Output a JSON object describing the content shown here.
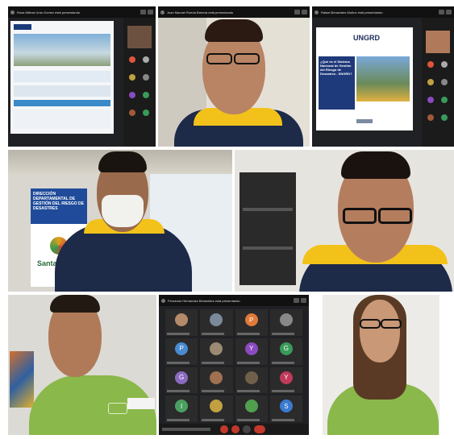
{
  "window_titles": {
    "top_left": "Rosa Milena Uran Gomez está presentando",
    "top_middle": "Juan Manuel Rueda Barrera está presentando",
    "top_right": "Rafael Benavides Muñoz está presentando",
    "bottom_middle": "Fernando Hernandez Benavides está presentando"
  },
  "slide": {
    "logo": "UNGRD",
    "question": "¿Qué es el Sistema Nacional de Gestión del Riesgo de Desastres - SNGRD?"
  },
  "banner": {
    "text": "DIRECCIÓN DEPARTAMENTAL DE GESTIÓN DEL RIESGO DE DESASTRES",
    "brand": "Santander"
  },
  "zoom_grid": {
    "avatars": [
      {
        "letter": "",
        "color": "#b48a6a"
      },
      {
        "letter": "",
        "color": "#7a8a9a"
      },
      {
        "letter": "P",
        "color": "#e07a3a"
      },
      {
        "letter": "",
        "color": "#888888"
      },
      {
        "letter": "P",
        "color": "#4a8ad0"
      },
      {
        "letter": "",
        "color": "#9c8a72"
      },
      {
        "letter": "Y",
        "color": "#8a4ac0"
      },
      {
        "letter": "G",
        "color": "#3a9a5a"
      },
      {
        "letter": "G",
        "color": "#8a6ac0"
      },
      {
        "letter": "",
        "color": "#a07050"
      },
      {
        "letter": "",
        "color": "#70604a"
      },
      {
        "letter": "Y",
        "color": "#c03a5a"
      },
      {
        "letter": "I",
        "color": "#4aa060"
      },
      {
        "letter": "",
        "color": "#c0a040"
      },
      {
        "letter": "",
        "color": "#50a050"
      },
      {
        "letter": "S",
        "color": "#3a7ad0"
      }
    ]
  },
  "colors": {
    "accent_green": "#8ab84a",
    "accent_yellow": "#f2c21a",
    "navy": "#1f2a4a",
    "meeting_bg": "#202124"
  }
}
